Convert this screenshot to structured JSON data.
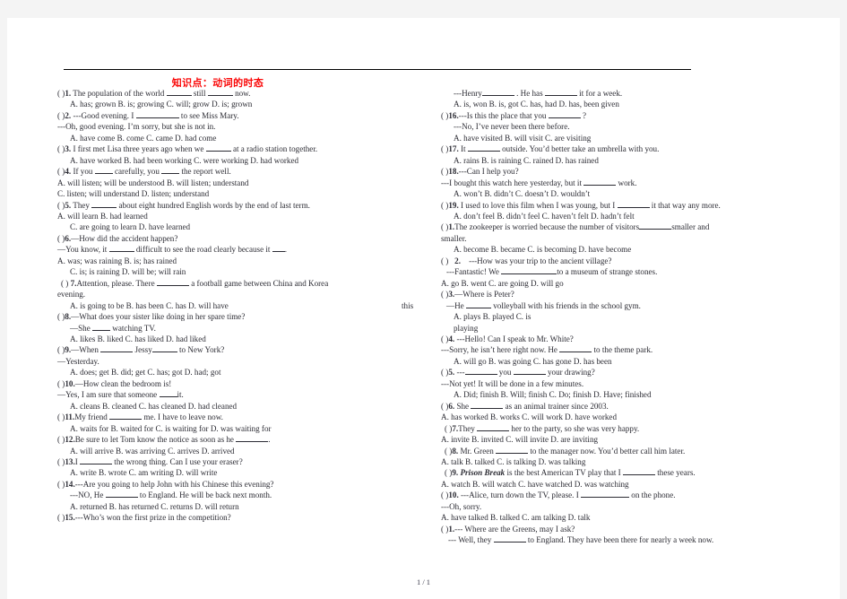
{
  "document": {
    "title": "知识点：动词的时态",
    "title_color": "#fa0808",
    "footer": "1 / 1",
    "overflow_fragment": "this"
  },
  "left_column": [
    {
      "bracket": "(    )",
      "number": "1.",
      "stem_pre": " The population of the world ",
      "stem_mid": " still ",
      "stem_post": " now.",
      "options": "A. has; grown          B. is; growing          C. will; grow        D. is; grown"
    },
    {
      "bracket": "(    )",
      "number": "2.",
      "stem_pre": " ---Good evening. I ",
      "stem_post": " to see Miss Mary.",
      "continuation": "---Oh, good evening. I’m sorry, but she is not in.",
      "options": "A. have come              B. come            C. came           D. had come"
    },
    {
      "bracket": "(    )",
      "number": "3.",
      "stem_pre": " I first met Lisa three years ago when we ",
      "stem_post": " at a radio station together.",
      "options": "A. have worked    B. had been working   C. were working    D. had worked"
    },
    {
      "bracket": "(    )",
      "number": "4.",
      "stem_pre": " If you ",
      "stem_mid": " carefully, you ",
      "stem_post": " the report well.",
      "options_line1": "A. will listen; will be understood          B. will listen; understand",
      "options_line2": "C. listen; will understand                  D. listen; understand"
    },
    {
      "bracket": "(    )",
      "number": "5.",
      "stem_pre": " They ",
      "stem_post": "  about eight hundred English words by the end of last term.",
      "options_line1": "A. will learn                                B. had learned",
      "options_line2": "C. are going to learn                      D. have learned"
    },
    {
      "bracket": "(    )",
      "number": "6.",
      "stem_pre": "—How did the accident happen?",
      "continuation_pre": "—You know, it ",
      "continuation_mid": " difficult to see the road clearly because it  ",
      "continuation_post": ".",
      "options_line1": "A. was; was raining                        B. is; has rained",
      "options_line2": "C. is; is raining                          D. will be; will rain"
    },
    {
      "bracket": "(    )",
      "number": "7.",
      "stem_pre": "Attention, please. There ",
      "stem_post": "    a football game between China and Korea ",
      "continuation": "evening.",
      "options": "A. is going to be      B. has been    C. has                   D. will have"
    },
    {
      "bracket": "(    )",
      "number": "8.",
      "stem_pre": "—What does your sister like doing in her spare time?",
      "continuation_pre": "—She ",
      "continuation_post": " watching TV.",
      "options": "A. likes        B. liked      C. has liked      D. had liked"
    },
    {
      "bracket": "(    )",
      "number": "9.",
      "stem_pre": "—When ",
      "stem_mid": " Jessy",
      "stem_post": " to New York?",
      "continuation": "—Yesterday.",
      "options": "A. does; get      B. did; get      C. has; got      D. had; got"
    },
    {
      "bracket": "(    )",
      "number": "10.",
      "stem_pre": "—How clean the bedroom is!",
      "continuation_pre": "—Yes, I am sure that someone    ",
      "continuation_post": "it.",
      "options": "A. cleans      B. cleaned      C. has cleaned      D. had cleaned"
    },
    {
      "bracket": "(    )",
      "number": "11.",
      "stem_pre": "My friend ",
      "stem_post": " me. I have to leave now.",
      "options": "A. waits for      B. waited for     C. is waiting for     D. was waiting for"
    },
    {
      "bracket": "(    )",
      "number": "12.",
      "stem_pre": "Be sure to let Tom know the notice as soon as he ",
      "stem_post": ".",
      "options": "A. will arrive         B. was arriving         C. arrives        D. arrived"
    },
    {
      "bracket": "(    )",
      "number": "13.",
      "stem_pre": "I ",
      "stem_post": " the wrong thing. Can I use your eraser?",
      "options": "A. write       B. wrote       C. am writing       D. will write"
    },
    {
      "bracket": "(    )",
      "number": "14.",
      "stem_pre": "---Are you going to help John with his Chinese this evening?",
      "continuation_pre": "---NO, He ",
      "continuation_post": " to England. He will be back next month.",
      "options": "A. returned       B. has returned      C. returns       D. will return"
    },
    {
      "bracket": "(    )",
      "number": "15.",
      "stem_pre": "---Who’s won the first prize in the competition?"
    }
  ],
  "right_column": [
    {
      "continuation_pre": "---Henry",
      "continuation_mid": " . He has ",
      "continuation_post": " it for a week.",
      "options": "A. is, won       B. is, got       C. has, had        D. has, been given"
    },
    {
      "bracket": "(    )",
      "number": "16.",
      "stem_pre": "---Is this the place that you ",
      "stem_post": " ?",
      "continuation": "---No, I’ve never been there before.",
      "options": "A. have visited          B. will visit               C. are visiting"
    },
    {
      "bracket": "(    )",
      "number": "17.",
      "stem_pre": " It ",
      "stem_post": " outside. You’d better take an umbrella with you.",
      "options": "A. rains   B. is raining     C. rained      D. has rained"
    },
    {
      "bracket": "(    )",
      "number": "18.",
      "stem_pre": "---Can I help you?",
      "continuation_pre": "---I bought this watch here yesterday, but it ",
      "continuation_post": " work.",
      "options": "A. won’t   B. didn’t    C. doesn’t      D. wouldn’t"
    },
    {
      "bracket": "(    )",
      "number": "19.",
      "stem_pre": " I used to love this film when I was young, but I ",
      "stem_post": " it that way any more.",
      "options": "A. don’t feel    B. didn’t feel     C. haven’t felt     D. hadn’t felt"
    },
    {
      "bracket": "(    )",
      "number": "1.",
      "stem_pre": "The zookeeper is worried because the number of visitors",
      "stem_post": "smaller and",
      "continuation": "smaller.",
      "options": "A. become            B. became     C. is becoming    D. have become"
    },
    {
      "bracket": "(               )",
      "number": "2.",
      "stem_pre": "---How was     your     trip to the     ancient     village?",
      "continuation_pre": "---Fantastic!        We        ",
      "continuation_post": "to a        museum of     strange      stones.",
      "options": "A. go        B. went    C. are going      D. will go"
    },
    {
      "bracket": "(    )",
      "number": "3.",
      "stem_pre": "—Where is Peter?",
      "continuation_pre": "—He ",
      "continuation_post": "     volleyball with his friends in the school gym.",
      "options_line1": "A. plays                                 B. played                                C.            is",
      "options_line2": "playing"
    },
    {
      "bracket": "(    )",
      "number": "4.",
      "stem_pre": " ---Hello! Can I speak to Mr. White?",
      "continuation_pre": "---Sorry, he isn’t here right now. He ",
      "continuation_post": " to the theme park.",
      "options": "A. will go      B. was going     C. has gone        D. has been"
    },
    {
      "bracket": "(    )",
      "number": "5.",
      "stem_pre": " ---",
      "stem_mid": " you ",
      "stem_post": " your drawing?",
      "continuation": "---Not yet! It will be done in a few minutes.",
      "options": "A. Did; finish          B. Will; finish        C. Do; finish            D. Have; finished"
    },
    {
      "bracket": "(    )",
      "number": "6.",
      "stem_pre": " She ",
      "stem_post": " as an animal trainer since 2003.",
      "options": "A. has worked        B. works       C. will work            D. have worked"
    },
    {
      "bracket": "(    )",
      "number": "7.",
      "stem_pre": "They ",
      "stem_post": " her to the party, so she was very happy.",
      "options": "A. invite        B. invited       C. will invite           D. are inviting"
    },
    {
      "bracket": "(    )",
      "number": "8.",
      "stem_pre": " Mr. Green ",
      "stem_post": " to the manager now. You’d better call him later.",
      "options": "A. talk         B. talked       C. is talking        D. was talking"
    },
    {
      "bracket": "(    )",
      "number": "9.",
      "italic_title": "Prison Break",
      "stem_pre": " ",
      "stem_post": " is the best American TV play that I ",
      "stem_tail": " these years.",
      "options": "A. watch         B. will watch      C. have watched       D. was watching"
    },
    {
      "bracket": "(    )",
      "number": "10.",
      "stem_pre": " ---Alice, turn down the TV, please. I ",
      "stem_post": " on the phone.",
      "continuation": "---Oh, sorry.",
      "options": "A. have talked        B. talked             C. am talking         D. talk"
    },
    {
      "bracket": "(    )",
      "number": "1.",
      "stem_pre": "--- Where are the Greens, may I ask?",
      "continuation_pre": "--- Well, they ",
      "continuation_post": " to England. They have been there for nearly a week now."
    }
  ]
}
